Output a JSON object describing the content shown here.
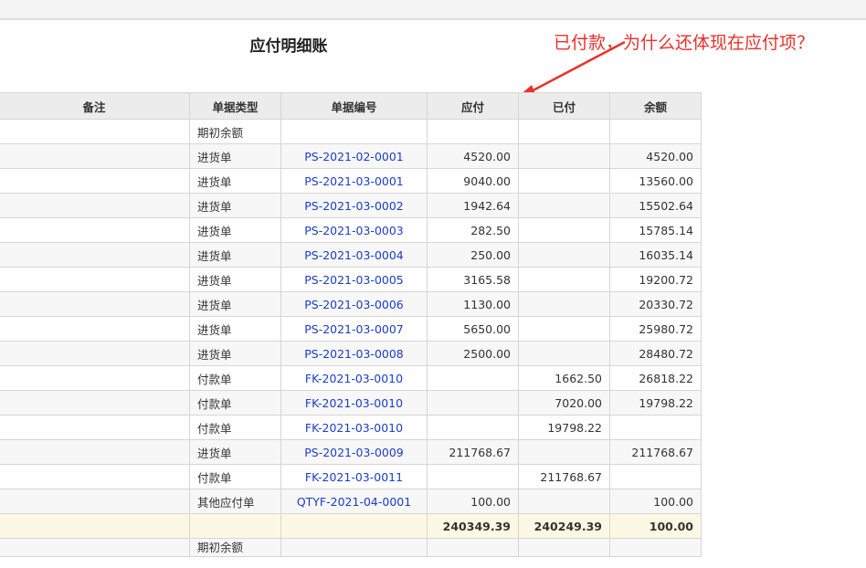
{
  "report": {
    "title": "应付明细账"
  },
  "annotation": {
    "text": "已付款，为什么还体现在应付项？",
    "color": "#e8322b"
  },
  "table": {
    "columns": [
      "备注",
      "单据类型",
      "单据编号",
      "应付",
      "已付",
      "余额"
    ],
    "rows": [
      {
        "note": "",
        "type": "期初余额",
        "code": "",
        "payable": "",
        "paid": "",
        "balance": ""
      },
      {
        "note": "",
        "type": "进货单",
        "code": "PS-2021-02-0001",
        "payable": "4520.00",
        "paid": "",
        "balance": "4520.00"
      },
      {
        "note": "",
        "type": "进货单",
        "code": "PS-2021-03-0001",
        "payable": "9040.00",
        "paid": "",
        "balance": "13560.00"
      },
      {
        "note": "",
        "type": "进货单",
        "code": "PS-2021-03-0002",
        "payable": "1942.64",
        "paid": "",
        "balance": "15502.64"
      },
      {
        "note": "",
        "type": "进货单",
        "code": "PS-2021-03-0003",
        "payable": "282.50",
        "paid": "",
        "balance": "15785.14"
      },
      {
        "note": "",
        "type": "进货单",
        "code": "PS-2021-03-0004",
        "payable": "250.00",
        "paid": "",
        "balance": "16035.14"
      },
      {
        "note": "",
        "type": "进货单",
        "code": "PS-2021-03-0005",
        "payable": "3165.58",
        "paid": "",
        "balance": "19200.72"
      },
      {
        "note": "",
        "type": "进货单",
        "code": "PS-2021-03-0006",
        "payable": "1130.00",
        "paid": "",
        "balance": "20330.72"
      },
      {
        "note": "",
        "type": "进货单",
        "code": "PS-2021-03-0007",
        "payable": "5650.00",
        "paid": "",
        "balance": "25980.72"
      },
      {
        "note": "",
        "type": "进货单",
        "code": "PS-2021-03-0008",
        "payable": "2500.00",
        "paid": "",
        "balance": "28480.72"
      },
      {
        "note": "",
        "type": "付款单",
        "code": "FK-2021-03-0010",
        "payable": "",
        "paid": "1662.50",
        "balance": "26818.22"
      },
      {
        "note": "",
        "type": "付款单",
        "code": "FK-2021-03-0010",
        "payable": "",
        "paid": "7020.00",
        "balance": "19798.22"
      },
      {
        "note": "",
        "type": "付款单",
        "code": "FK-2021-03-0010",
        "payable": "",
        "paid": "19798.22",
        "balance": ""
      },
      {
        "note": "",
        "type": "进货单",
        "code": "PS-2021-03-0009",
        "payable": "211768.67",
        "paid": "",
        "balance": "211768.67"
      },
      {
        "note": "",
        "type": "付款单",
        "code": "FK-2021-03-0011",
        "payable": "",
        "paid": "211768.67",
        "balance": ""
      },
      {
        "note": "",
        "type": "其他应付单",
        "code": "QTYF-2021-04-0001",
        "payable": "100.00",
        "paid": "",
        "balance": "100.00"
      }
    ],
    "totals": {
      "payable": "240349.39",
      "paid": "240249.39",
      "balance": "100.00"
    },
    "next_row_type": "期初余额"
  }
}
